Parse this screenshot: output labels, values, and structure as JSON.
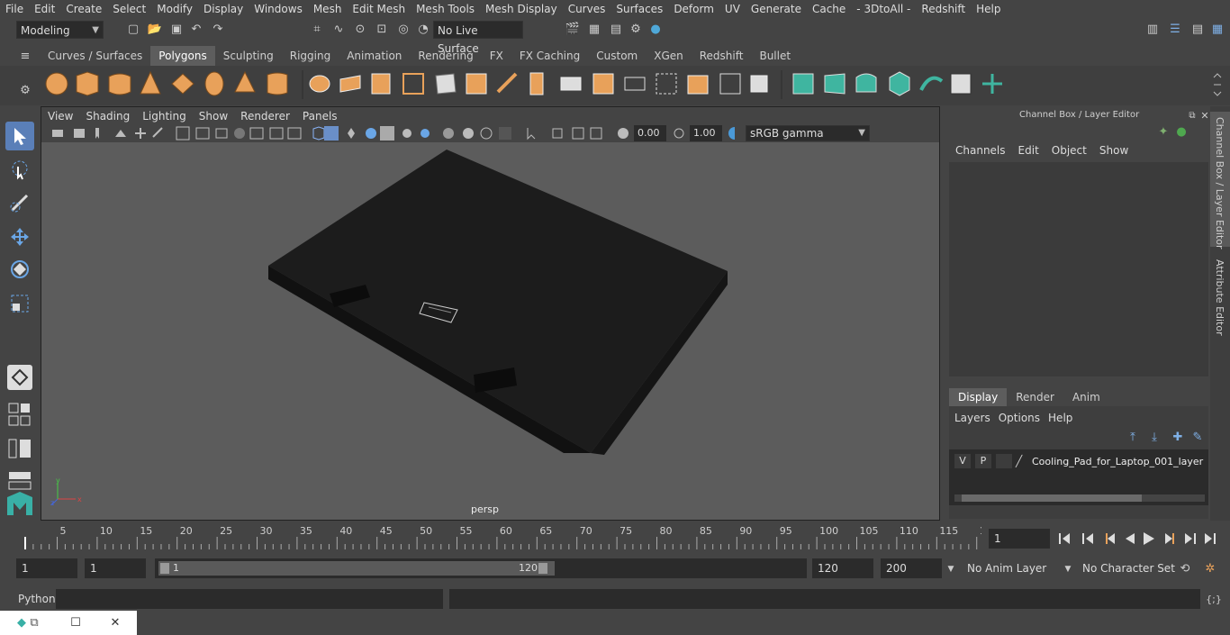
{
  "menubar": [
    "File",
    "Edit",
    "Create",
    "Select",
    "Modify",
    "Display",
    "Windows",
    "Mesh",
    "Edit Mesh",
    "Mesh Tools",
    "Mesh Display",
    "Curves",
    "Surfaces",
    "Deform",
    "UV",
    "Generate",
    "Cache",
    "- 3DtoAll -",
    "Redshift",
    "Help"
  ],
  "status": {
    "mode": "Modeling",
    "live_surface": "No Live Surface"
  },
  "shelf": {
    "tabs": [
      "Curves / Surfaces",
      "Polygons",
      "Sculpting",
      "Rigging",
      "Animation",
      "Rendering",
      "FX",
      "FX Caching",
      "Custom",
      "XGen",
      "Redshift",
      "Bullet"
    ],
    "active_tab": "Polygons"
  },
  "viewport": {
    "menu": [
      "View",
      "Shading",
      "Lighting",
      "Show",
      "Renderer",
      "Panels"
    ],
    "exposure": "0.00",
    "gamma": "1.00",
    "color_space": "sRGB gamma",
    "camera_label": "persp"
  },
  "channel_box": {
    "title": "Channel Box / Layer Editor",
    "menu": [
      "Channels",
      "Edit",
      "Object",
      "Show"
    ],
    "layer_tabs": [
      "Display",
      "Render",
      "Anim"
    ],
    "active_layer_tab": "Display",
    "layer_menu": [
      "Layers",
      "Options",
      "Help"
    ],
    "layer": {
      "v": "V",
      "p": "P",
      "name": "Cooling_Pad_for_Laptop_001_layer"
    }
  },
  "side_tabs": [
    "Channel Box / Layer Editor",
    "Attribute Editor"
  ],
  "timeline": {
    "ticks": [
      "5",
      "10",
      "15",
      "20",
      "25",
      "30",
      "35",
      "40",
      "45",
      "50",
      "55",
      "60",
      "65",
      "70",
      "75",
      "80",
      "85",
      "90",
      "95",
      "100",
      "105",
      "110",
      "115",
      "12"
    ],
    "start_label": "1",
    "current_frame": "1"
  },
  "range": {
    "start": "1",
    "start2": "1",
    "slider_start": "1",
    "slider_end": "120",
    "end": "120",
    "max": "200",
    "anim_layer": "No Anim Layer",
    "character_set": "No Character Set"
  },
  "cmd": {
    "label": "Python"
  },
  "colors": {
    "accent_orange": "#e8a15a",
    "accent_teal": "#39b0a6",
    "accent_blue": "#5a8fd6",
    "active_tool": "#5a7fb8"
  }
}
